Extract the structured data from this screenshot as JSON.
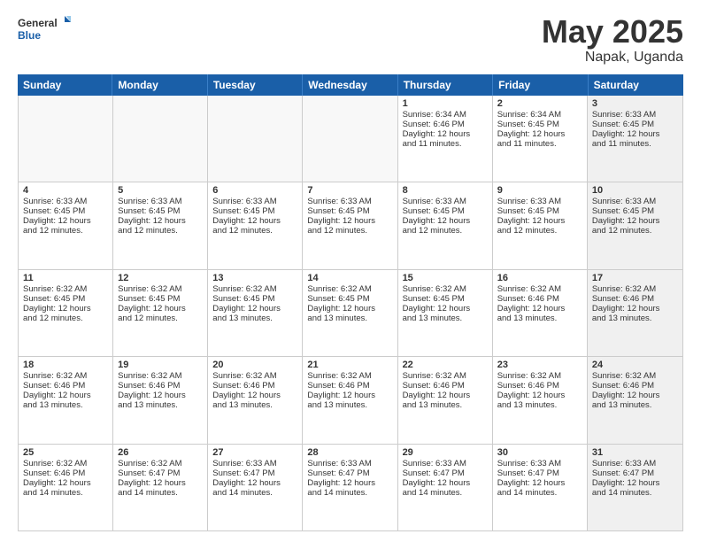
{
  "logo": {
    "general": "General",
    "blue": "Blue"
  },
  "title": "May 2025",
  "location": "Napak, Uganda",
  "days_of_week": [
    "Sunday",
    "Monday",
    "Tuesday",
    "Wednesday",
    "Thursday",
    "Friday",
    "Saturday"
  ],
  "weeks": [
    [
      {
        "day": "",
        "info": "",
        "empty": true
      },
      {
        "day": "",
        "info": "",
        "empty": true
      },
      {
        "day": "",
        "info": "",
        "empty": true
      },
      {
        "day": "",
        "info": "",
        "empty": true
      },
      {
        "day": "1",
        "info": "Sunrise: 6:34 AM\nSunset: 6:46 PM\nDaylight: 12 hours\nand 11 minutes.",
        "shaded": false
      },
      {
        "day": "2",
        "info": "Sunrise: 6:34 AM\nSunset: 6:45 PM\nDaylight: 12 hours\nand 11 minutes.",
        "shaded": false
      },
      {
        "day": "3",
        "info": "Sunrise: 6:33 AM\nSunset: 6:45 PM\nDaylight: 12 hours\nand 11 minutes.",
        "shaded": true
      }
    ],
    [
      {
        "day": "4",
        "info": "Sunrise: 6:33 AM\nSunset: 6:45 PM\nDaylight: 12 hours\nand 12 minutes.",
        "shaded": false
      },
      {
        "day": "5",
        "info": "Sunrise: 6:33 AM\nSunset: 6:45 PM\nDaylight: 12 hours\nand 12 minutes.",
        "shaded": false
      },
      {
        "day": "6",
        "info": "Sunrise: 6:33 AM\nSunset: 6:45 PM\nDaylight: 12 hours\nand 12 minutes.",
        "shaded": false
      },
      {
        "day": "7",
        "info": "Sunrise: 6:33 AM\nSunset: 6:45 PM\nDaylight: 12 hours\nand 12 minutes.",
        "shaded": false
      },
      {
        "day": "8",
        "info": "Sunrise: 6:33 AM\nSunset: 6:45 PM\nDaylight: 12 hours\nand 12 minutes.",
        "shaded": false
      },
      {
        "day": "9",
        "info": "Sunrise: 6:33 AM\nSunset: 6:45 PM\nDaylight: 12 hours\nand 12 minutes.",
        "shaded": false
      },
      {
        "day": "10",
        "info": "Sunrise: 6:33 AM\nSunset: 6:45 PM\nDaylight: 12 hours\nand 12 minutes.",
        "shaded": true
      }
    ],
    [
      {
        "day": "11",
        "info": "Sunrise: 6:32 AM\nSunset: 6:45 PM\nDaylight: 12 hours\nand 12 minutes.",
        "shaded": false
      },
      {
        "day": "12",
        "info": "Sunrise: 6:32 AM\nSunset: 6:45 PM\nDaylight: 12 hours\nand 12 minutes.",
        "shaded": false
      },
      {
        "day": "13",
        "info": "Sunrise: 6:32 AM\nSunset: 6:45 PM\nDaylight: 12 hours\nand 13 minutes.",
        "shaded": false
      },
      {
        "day": "14",
        "info": "Sunrise: 6:32 AM\nSunset: 6:45 PM\nDaylight: 12 hours\nand 13 minutes.",
        "shaded": false
      },
      {
        "day": "15",
        "info": "Sunrise: 6:32 AM\nSunset: 6:45 PM\nDaylight: 12 hours\nand 13 minutes.",
        "shaded": false
      },
      {
        "day": "16",
        "info": "Sunrise: 6:32 AM\nSunset: 6:46 PM\nDaylight: 12 hours\nand 13 minutes.",
        "shaded": false
      },
      {
        "day": "17",
        "info": "Sunrise: 6:32 AM\nSunset: 6:46 PM\nDaylight: 12 hours\nand 13 minutes.",
        "shaded": true
      }
    ],
    [
      {
        "day": "18",
        "info": "Sunrise: 6:32 AM\nSunset: 6:46 PM\nDaylight: 12 hours\nand 13 minutes.",
        "shaded": false
      },
      {
        "day": "19",
        "info": "Sunrise: 6:32 AM\nSunset: 6:46 PM\nDaylight: 12 hours\nand 13 minutes.",
        "shaded": false
      },
      {
        "day": "20",
        "info": "Sunrise: 6:32 AM\nSunset: 6:46 PM\nDaylight: 12 hours\nand 13 minutes.",
        "shaded": false
      },
      {
        "day": "21",
        "info": "Sunrise: 6:32 AM\nSunset: 6:46 PM\nDaylight: 12 hours\nand 13 minutes.",
        "shaded": false
      },
      {
        "day": "22",
        "info": "Sunrise: 6:32 AM\nSunset: 6:46 PM\nDaylight: 12 hours\nand 13 minutes.",
        "shaded": false
      },
      {
        "day": "23",
        "info": "Sunrise: 6:32 AM\nSunset: 6:46 PM\nDaylight: 12 hours\nand 13 minutes.",
        "shaded": false
      },
      {
        "day": "24",
        "info": "Sunrise: 6:32 AM\nSunset: 6:46 PM\nDaylight: 12 hours\nand 13 minutes.",
        "shaded": true
      }
    ],
    [
      {
        "day": "25",
        "info": "Sunrise: 6:32 AM\nSunset: 6:46 PM\nDaylight: 12 hours\nand 14 minutes.",
        "shaded": false
      },
      {
        "day": "26",
        "info": "Sunrise: 6:32 AM\nSunset: 6:47 PM\nDaylight: 12 hours\nand 14 minutes.",
        "shaded": false
      },
      {
        "day": "27",
        "info": "Sunrise: 6:33 AM\nSunset: 6:47 PM\nDaylight: 12 hours\nand 14 minutes.",
        "shaded": false
      },
      {
        "day": "28",
        "info": "Sunrise: 6:33 AM\nSunset: 6:47 PM\nDaylight: 12 hours\nand 14 minutes.",
        "shaded": false
      },
      {
        "day": "29",
        "info": "Sunrise: 6:33 AM\nSunset: 6:47 PM\nDaylight: 12 hours\nand 14 minutes.",
        "shaded": false
      },
      {
        "day": "30",
        "info": "Sunrise: 6:33 AM\nSunset: 6:47 PM\nDaylight: 12 hours\nand 14 minutes.",
        "shaded": false
      },
      {
        "day": "31",
        "info": "Sunrise: 6:33 AM\nSunset: 6:47 PM\nDaylight: 12 hours\nand 14 minutes.",
        "shaded": true
      }
    ]
  ]
}
